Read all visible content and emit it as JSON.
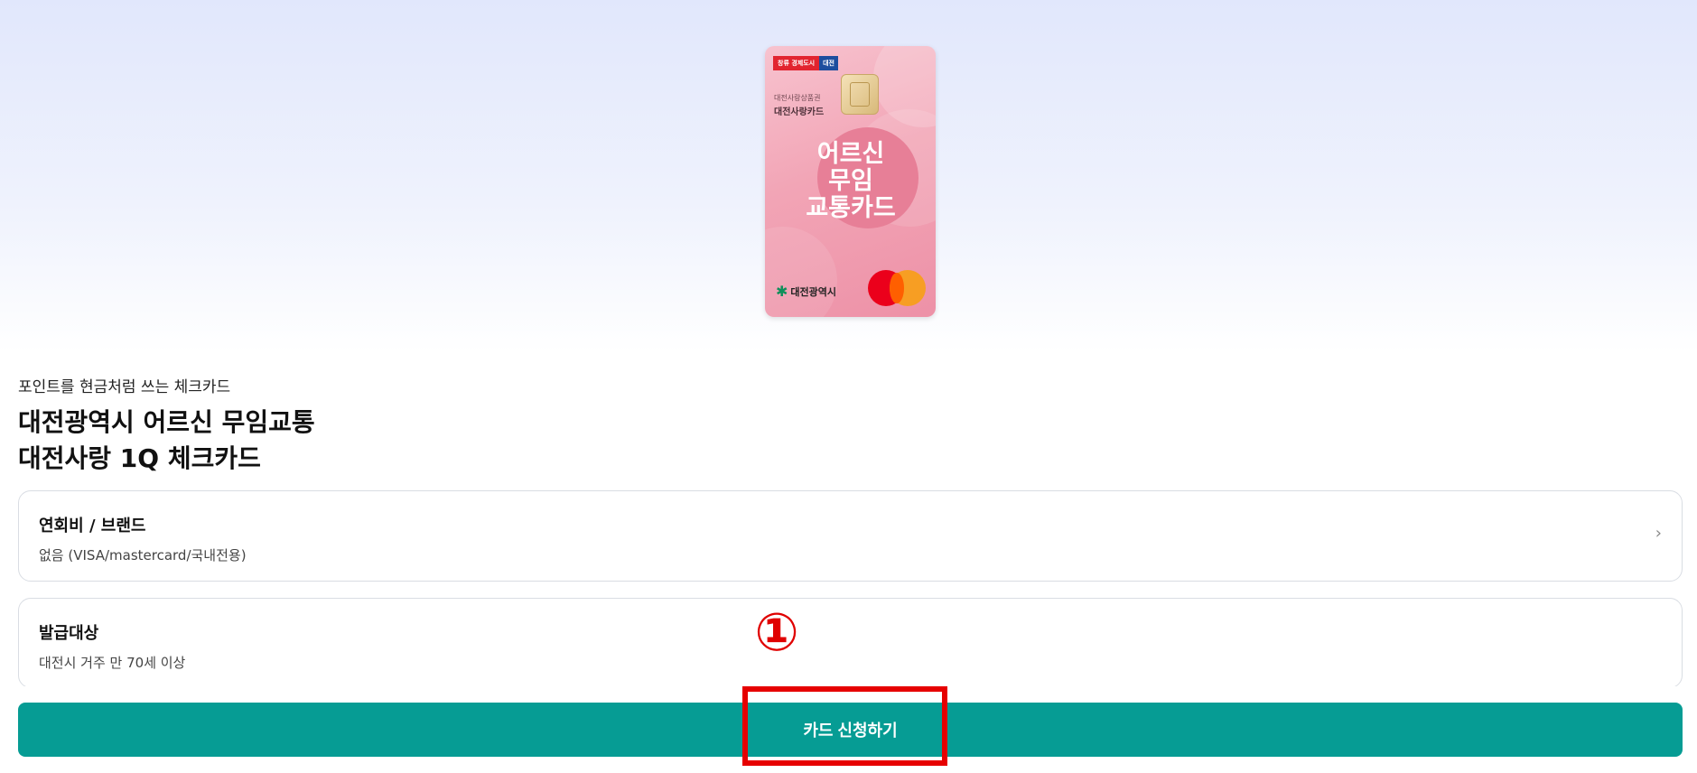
{
  "card_image": {
    "badge_red": "창류 경제도시",
    "badge_blue": "대전",
    "sub_label_1": "대전사랑상품권",
    "sub_label_2": "대전사랑카드",
    "title": "어르신\n무임\n교통카드",
    "city_logo_text": "대전광역시",
    "network_icon": "mastercard-icon"
  },
  "product": {
    "subtitle": "포인트를 현금처럼 쓰는 체크카드",
    "title_line1": "대전광역시 어르신 무임교통",
    "title_line2": "대전사랑 1Q 체크카드"
  },
  "info": [
    {
      "label": "연회비 / 브랜드",
      "value": "없음 (VISA/mastercard/국내전용)"
    },
    {
      "label": "발급대상",
      "value": "대전시 거주 만 70세 이상"
    }
  ],
  "annotation": {
    "marker": "①",
    "color": "#e60000"
  },
  "apply_button": {
    "label": "카드 신청하기",
    "color": "#069c94"
  }
}
